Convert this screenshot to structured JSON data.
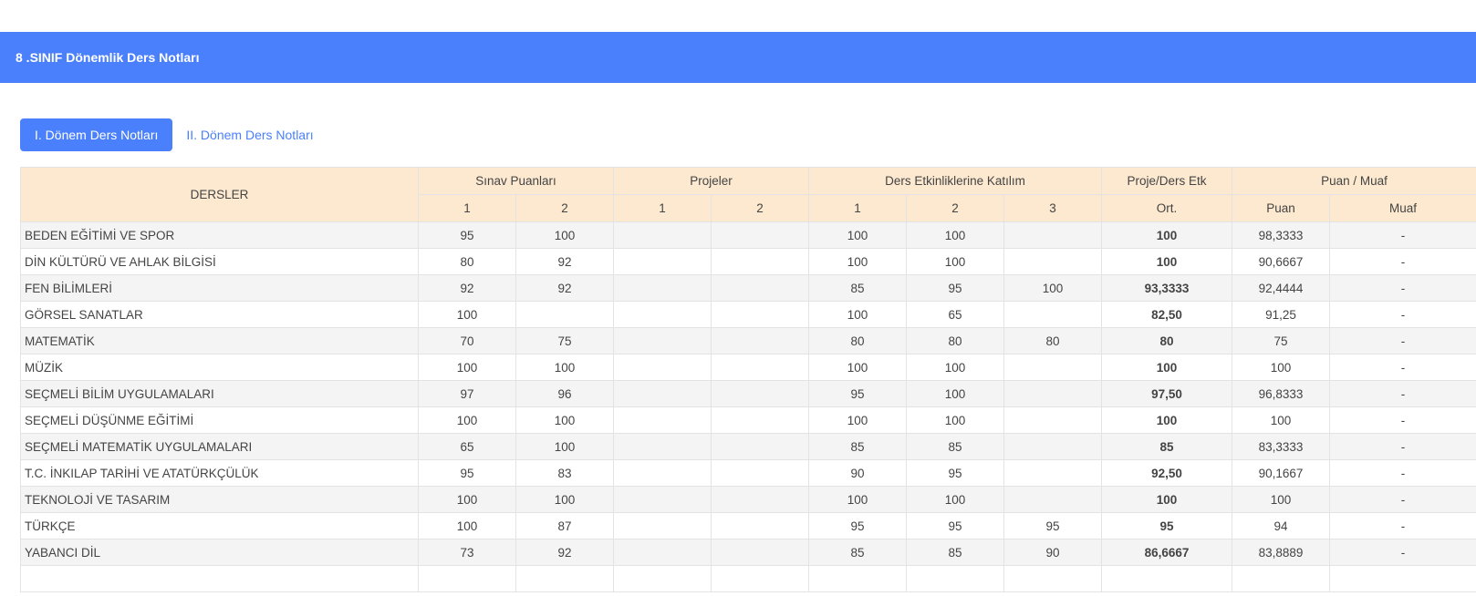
{
  "header": {
    "title": "8 .SINIF Dönemlik Ders Notları"
  },
  "tabs": [
    {
      "label": "I. Dönem Ders Notları",
      "active": true
    },
    {
      "label": "II. Dönem Ders Notları",
      "active": false
    }
  ],
  "table": {
    "groups": {
      "dersler": "DERSLER",
      "sinav": "Sınav Puanları",
      "projeler": "Projeler",
      "etkinlik": "Ders Etkinliklerine Katılım",
      "proje_etk": "Proje/Ders Etk",
      "puan_muaf": "Puan / Muaf"
    },
    "subheaders": [
      "1",
      "2",
      "1",
      "2",
      "1",
      "2",
      "3",
      "Ort.",
      "Puan",
      "Muaf"
    ],
    "rows": [
      {
        "name": "BEDEN EĞİTİMİ VE SPOR",
        "cells": [
          "95",
          "100",
          "",
          "",
          "100",
          "100",
          "",
          "100",
          "98,3333",
          "-"
        ]
      },
      {
        "name": "DİN KÜLTÜRÜ VE AHLAK BİLGİSİ",
        "cells": [
          "80",
          "92",
          "",
          "",
          "100",
          "100",
          "",
          "100",
          "90,6667",
          "-"
        ]
      },
      {
        "name": "FEN BİLİMLERİ",
        "cells": [
          "92",
          "92",
          "",
          "",
          "85",
          "95",
          "100",
          "93,3333",
          "92,4444",
          "-"
        ]
      },
      {
        "name": "GÖRSEL SANATLAR",
        "cells": [
          "100",
          "",
          "",
          "",
          "100",
          "65",
          "",
          "82,50",
          "91,25",
          "-"
        ]
      },
      {
        "name": "MATEMATİK",
        "cells": [
          "70",
          "75",
          "",
          "",
          "80",
          "80",
          "80",
          "80",
          "75",
          "-"
        ]
      },
      {
        "name": "MÜZİK",
        "cells": [
          "100",
          "100",
          "",
          "",
          "100",
          "100",
          "",
          "100",
          "100",
          "-"
        ]
      },
      {
        "name": "SEÇMELİ BİLİM UYGULAMALARI",
        "cells": [
          "97",
          "96",
          "",
          "",
          "95",
          "100",
          "",
          "97,50",
          "96,8333",
          "-"
        ]
      },
      {
        "name": "SEÇMELİ DÜŞÜNME EĞİTİMİ",
        "cells": [
          "100",
          "100",
          "",
          "",
          "100",
          "100",
          "",
          "100",
          "100",
          "-"
        ]
      },
      {
        "name": "SEÇMELİ MATEMATİK UYGULAMALARI",
        "cells": [
          "65",
          "100",
          "",
          "",
          "85",
          "85",
          "",
          "85",
          "83,3333",
          "-"
        ]
      },
      {
        "name": "T.C. İNKILAP TARİHİ VE ATATÜRKÇÜLÜK",
        "cells": [
          "95",
          "83",
          "",
          "",
          "90",
          "95",
          "",
          "92,50",
          "90,1667",
          "-"
        ]
      },
      {
        "name": "TEKNOLOJİ VE TASARIM",
        "cells": [
          "100",
          "100",
          "",
          "",
          "100",
          "100",
          "",
          "100",
          "100",
          "-"
        ]
      },
      {
        "name": "TÜRKÇE",
        "cells": [
          "100",
          "87",
          "",
          "",
          "95",
          "95",
          "95",
          "95",
          "94",
          "-"
        ]
      },
      {
        "name": "YABANCI DİL",
        "cells": [
          "73",
          "92",
          "",
          "",
          "85",
          "85",
          "90",
          "86,6667",
          "83,8889",
          "-"
        ]
      },
      {
        "name": "",
        "cells": [
          "",
          "",
          "",
          "",
          "",
          "",
          "",
          "",
          "",
          ""
        ]
      }
    ]
  }
}
